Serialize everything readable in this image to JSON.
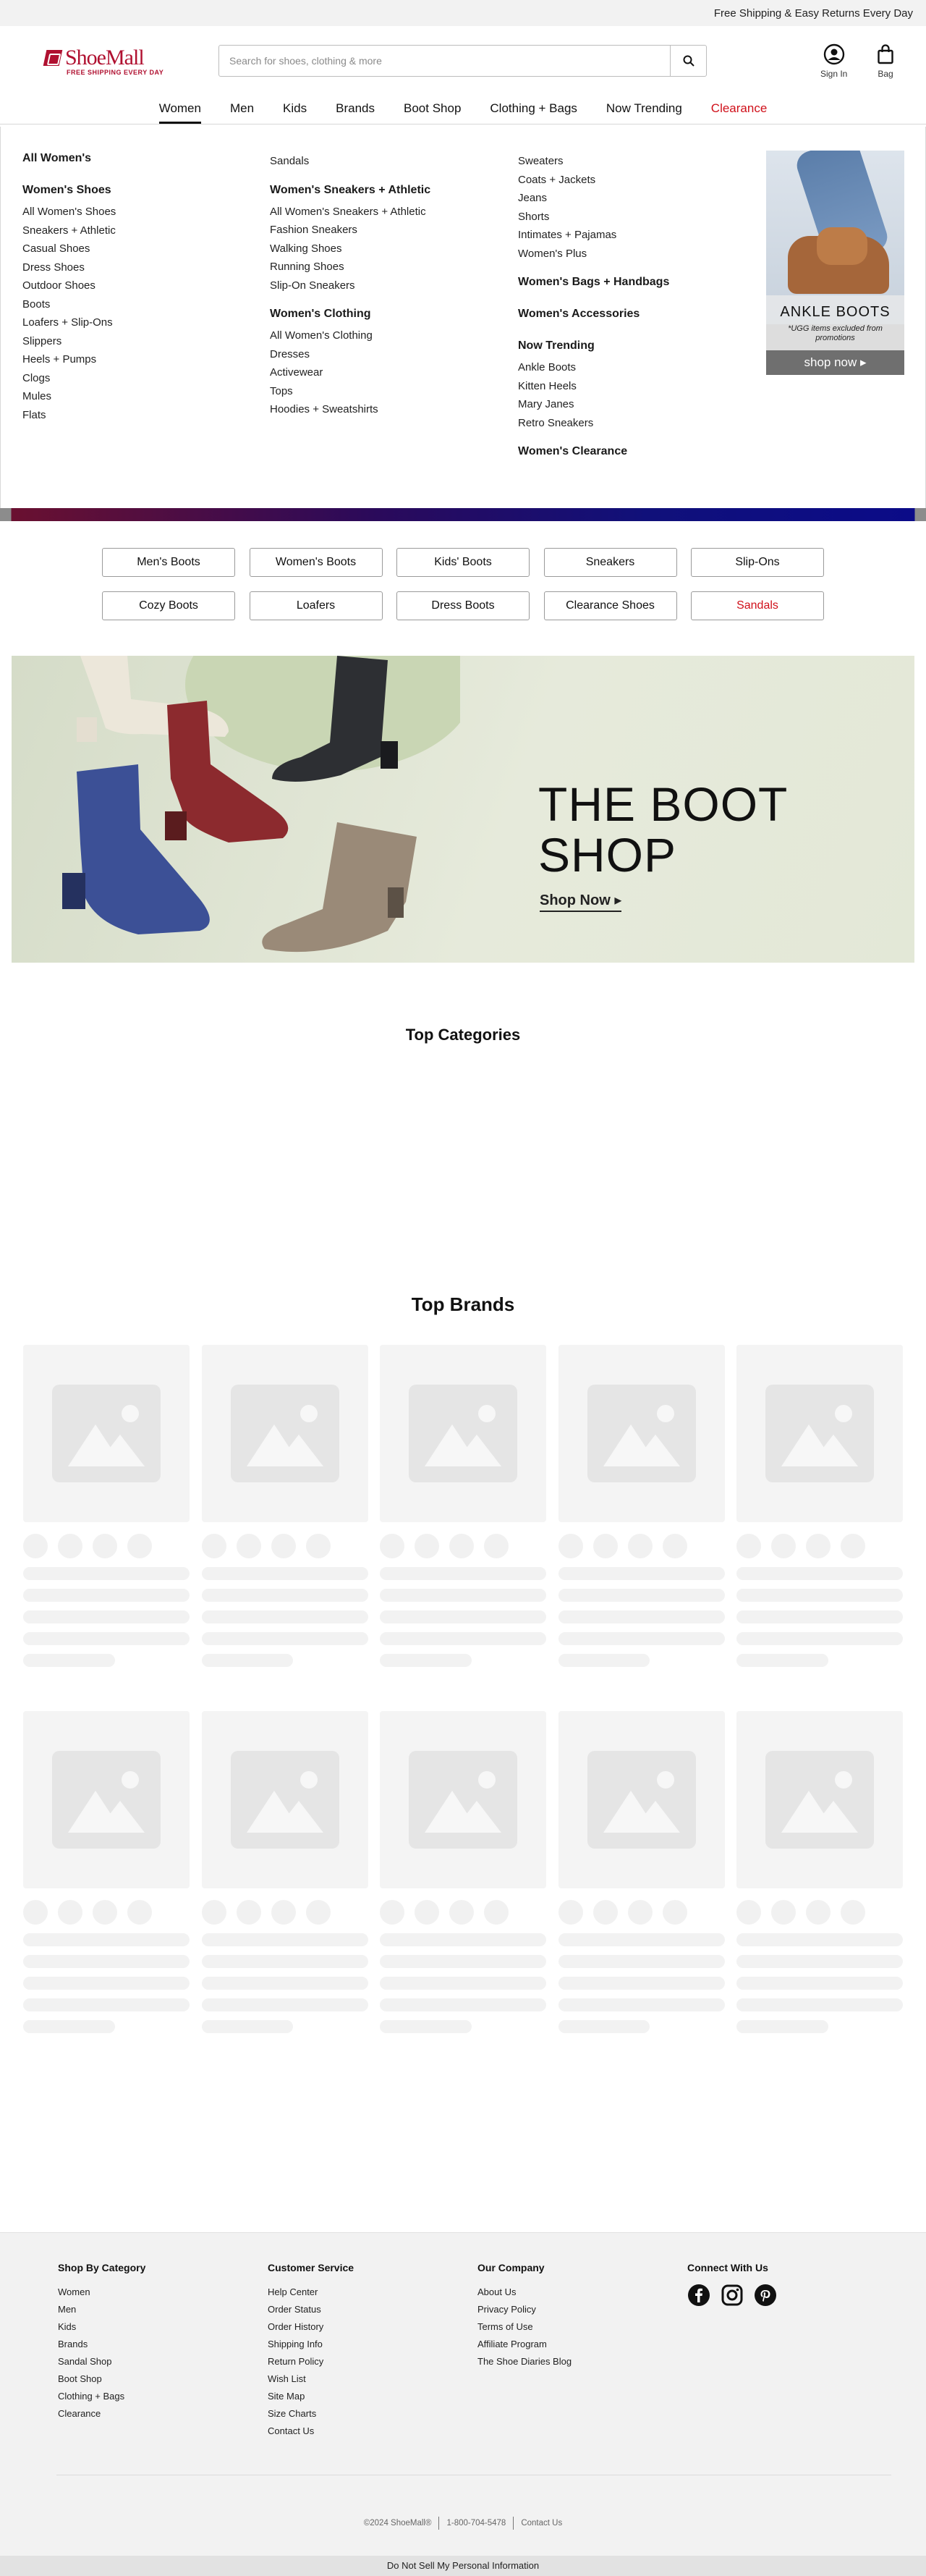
{
  "topbar": {
    "text": "Free Shipping & Easy Returns Every Day"
  },
  "header": {
    "logo_text": "ShoeMall",
    "logo_tagline": "FREE SHIPPING EVERY DAY",
    "search_placeholder": "Search for shoes, clothing & more",
    "sign_in_label": "Sign In",
    "bag_label": "Bag"
  },
  "nav": {
    "items": [
      {
        "label": "Women"
      },
      {
        "label": "Men"
      },
      {
        "label": "Kids"
      },
      {
        "label": "Brands"
      },
      {
        "label": "Boot Shop"
      },
      {
        "label": "Clothing + Bags"
      },
      {
        "label": "Now Trending"
      },
      {
        "label": "Clearance"
      }
    ]
  },
  "mega_menu": {
    "col1": {
      "all": "All Women's",
      "shoes_head": "Women's Shoes",
      "links": [
        "All Women's Shoes",
        "Sneakers + Athletic",
        "Casual Shoes",
        "Dress Shoes",
        "Outdoor Shoes",
        "Boots",
        "Loafers + Slip-Ons",
        "Slippers",
        "Heels + Pumps",
        "Clogs",
        "Mules",
        "Flats"
      ]
    },
    "col2": {
      "top_link": "Sandals",
      "sneakers_head": "Women's Sneakers + Athletic",
      "sneakers_links": [
        "All Women's Sneakers + Athletic",
        "Fashion Sneakers",
        "Walking Shoes",
        "Running Shoes",
        "Slip-On Sneakers"
      ],
      "clothing_head": "Women's Clothing",
      "clothing_links": [
        "All Women's Clothing",
        "Dresses",
        "Activewear",
        "Tops",
        "Hoodies + Sweatshirts"
      ]
    },
    "col3": {
      "top_links": [
        "Sweaters",
        "Coats + Jackets",
        "Jeans",
        "Shorts",
        "Intimates + Pajamas",
        "Women's Plus"
      ],
      "bags_head": "Women's Bags + Handbags",
      "accessories_head": "Women's Accessories",
      "trending_head": "Now Trending",
      "trending_links": [
        "Ankle Boots",
        "Kitten Heels",
        "Mary Janes",
        "Retro Sneakers"
      ],
      "clearance_head": "Women's Clearance"
    },
    "promo": {
      "title": "ANKLE BOOTS",
      "subtitle": "*UGG items excluded from promotions",
      "cta": "shop now ▸"
    }
  },
  "chips": [
    {
      "label": "Men's Boots"
    },
    {
      "label": "Women's Boots"
    },
    {
      "label": "Kids' Boots"
    },
    {
      "label": "Sneakers"
    },
    {
      "label": "Slip-Ons"
    },
    {
      "label": "Cozy Boots"
    },
    {
      "label": "Loafers"
    },
    {
      "label": "Dress Boots"
    },
    {
      "label": "Clearance Shoes"
    },
    {
      "label": "Sandals"
    }
  ],
  "hero": {
    "title_line1": "THE BOOT",
    "title_line2": "SHOP",
    "cta": "Shop Now ▸"
  },
  "sections": {
    "top_categories": "Top Categories",
    "top_brands": "Top Brands"
  },
  "footer": {
    "category": {
      "head": "Shop By Category",
      "links": [
        "Women",
        "Men",
        "Kids",
        "Brands",
        "Sandal Shop",
        "Boot Shop",
        "Clothing + Bags",
        "Clearance"
      ]
    },
    "service": {
      "head": "Customer Service",
      "links": [
        "Help Center",
        "Order Status",
        "Order History",
        "Shipping Info",
        "Return Policy",
        "Wish List",
        "Site Map",
        "Size Charts",
        "Contact Us"
      ]
    },
    "company": {
      "head": "Our Company",
      "links": [
        "About Us",
        "Privacy Policy",
        "Terms of Use",
        "Affiliate Program",
        "The Shoe Diaries Blog"
      ]
    },
    "connect": {
      "head": "Connect With Us"
    },
    "bottom": {
      "copyright": "©2024 ShoeMall®",
      "phone": "1-800-704-5478",
      "contact": "Contact Us"
    },
    "dnsmpi": "Do Not Sell My Personal Information"
  },
  "colors": {
    "brand_red": "#b01030",
    "clearance_red": "#d0101a",
    "footer_bg": "#f2f2f2"
  }
}
